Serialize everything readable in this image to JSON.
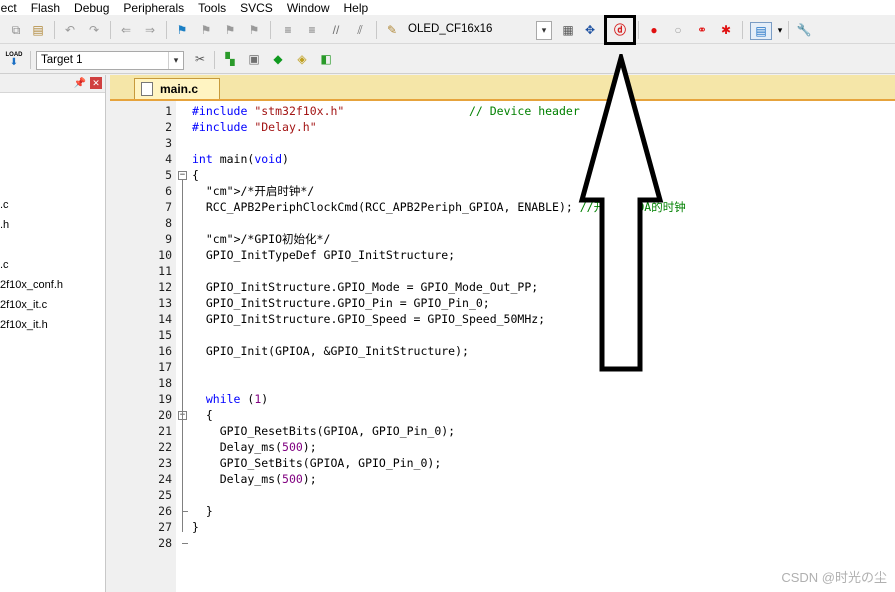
{
  "menu": [
    "ject",
    "Flash",
    "Debug",
    "Peripherals",
    "Tools",
    "SVCS",
    "Window",
    "Help"
  ],
  "toolbar": {
    "target_combo": "OLED_CF16x16",
    "target_select": "Target 1",
    "load_label": "LOAD"
  },
  "left_panel": {
    "files": [
      ".c",
      ".h",
      ".c",
      "2f10x_conf.h",
      "2f10x_it.c",
      "2f10x_it.h"
    ]
  },
  "editor": {
    "tab_label": "main.c",
    "lines": [
      {
        "n": "1",
        "code": "#include \"stm32f10x.h\"                  // Device header"
      },
      {
        "n": "2",
        "code": "#include \"Delay.h\""
      },
      {
        "n": "3",
        "code": ""
      },
      {
        "n": "4",
        "code": "int main(void)"
      },
      {
        "n": "5",
        "code": "{"
      },
      {
        "n": "6",
        "code": "  /*开启时钟*/"
      },
      {
        "n": "7",
        "code": "  RCC_APB2PeriphClockCmd(RCC_APB2Periph_GPIOA, ENABLE); //开启GPIOA的时钟"
      },
      {
        "n": "8",
        "code": ""
      },
      {
        "n": "9",
        "code": "  /*GPIO初始化*/"
      },
      {
        "n": "10",
        "code": "  GPIO_InitTypeDef GPIO_InitStructure;"
      },
      {
        "n": "11",
        "code": ""
      },
      {
        "n": "12",
        "code": "  GPIO_InitStructure.GPIO_Mode = GPIO_Mode_Out_PP;"
      },
      {
        "n": "13",
        "code": "  GPIO_InitStructure.GPIO_Pin = GPIO_Pin_0;"
      },
      {
        "n": "14",
        "code": "  GPIO_InitStructure.GPIO_Speed = GPIO_Speed_50MHz;"
      },
      {
        "n": "15",
        "code": ""
      },
      {
        "n": "16",
        "code": "  GPIO_Init(GPIOA, &GPIO_InitStructure);"
      },
      {
        "n": "17",
        "code": ""
      },
      {
        "n": "18",
        "code": ""
      },
      {
        "n": "19",
        "code": "  while (1)"
      },
      {
        "n": "20",
        "code": "  {"
      },
      {
        "n": "21",
        "code": "    GPIO_ResetBits(GPIOA, GPIO_Pin_0);"
      },
      {
        "n": "22",
        "code": "    Delay_ms(500);"
      },
      {
        "n": "23",
        "code": "    GPIO_SetBits(GPIOA, GPIO_Pin_0);"
      },
      {
        "n": "24",
        "code": "    Delay_ms(500);"
      },
      {
        "n": "25",
        "code": ""
      },
      {
        "n": "26",
        "code": "  }"
      },
      {
        "n": "27",
        "code": "}"
      },
      {
        "n": "28",
        "code": ""
      }
    ]
  },
  "watermark": "CSDN @时光の尘"
}
